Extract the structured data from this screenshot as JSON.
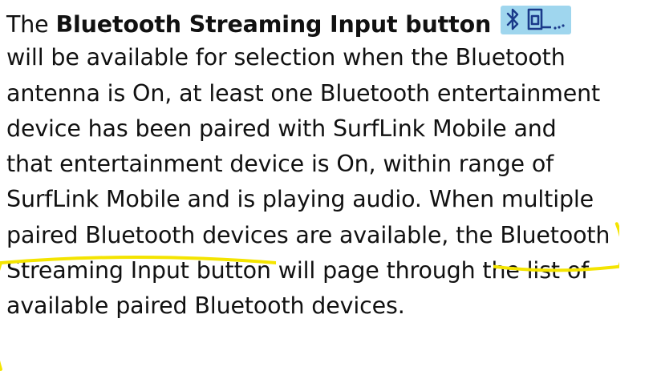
{
  "paragraph": {
    "line1_prefix": "The ",
    "line1_bold": "Bluetooth Streaming Input button",
    "line2": "will be available for selection when the Bluetooth",
    "line3": "antenna is On, at least one Bluetooth entertainment",
    "line4": "device has been paired with SurfLink Mobile and",
    "line5": "that entertainment device is On, within range of",
    "line6": "SurfLink Mobile and is playing audio. When multiple",
    "line7_prefix": "paired Bluetooth devices are available, the ",
    "line7_highlight": "Bluetooth",
    "line8_highlight": "Streaming Input button",
    "line8_suffix": " will page through the list of",
    "line9": "available paired Bluetooth devices."
  },
  "icon": {
    "name": "bluetooth-streaming-input-icon",
    "background": "#9fd6ee",
    "glyph_color": "#1a3a8a",
    "accent_color": "#1a3a8a"
  },
  "highlight_color": "#f4e400"
}
